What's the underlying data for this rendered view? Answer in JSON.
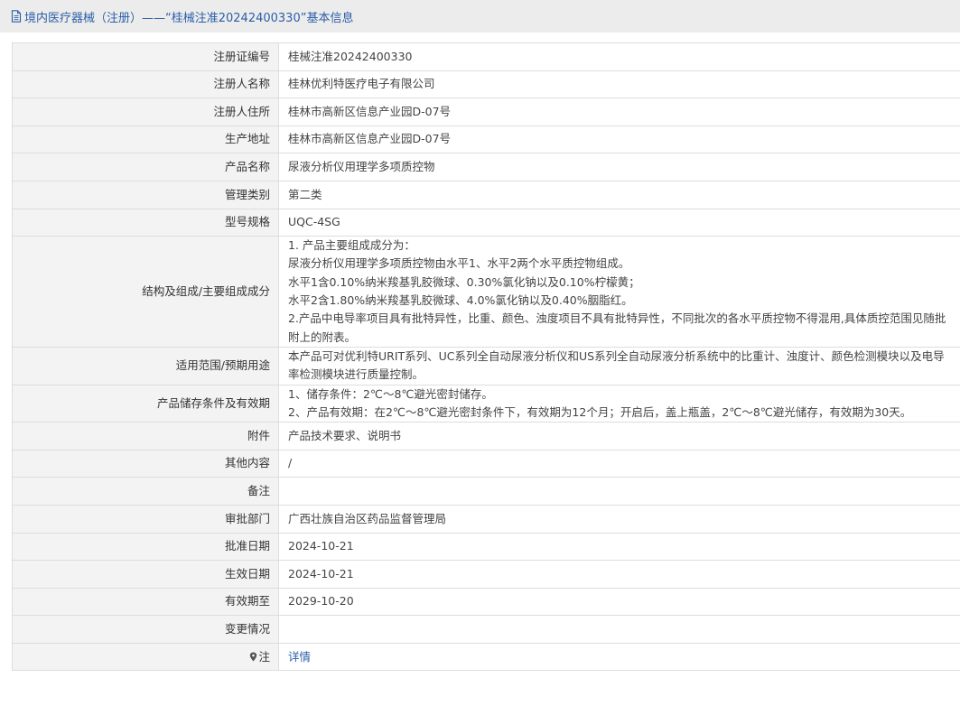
{
  "header": {
    "title": "境内医疗器械（注册）——“桂械注准20242400330”基本信息",
    "icon": "document-icon",
    "color": "#2a5ea8"
  },
  "rows": {
    "reg_no": {
      "label": "注册证编号",
      "value": "桂械注准20242400330"
    },
    "registrant": {
      "label": "注册人名称",
      "value": "桂林优利特医疗电子有限公司"
    },
    "registrant_address": {
      "label": "注册人住所",
      "value": "桂林市高新区信息产业园D-07号"
    },
    "production_address": {
      "label": "生产地址",
      "value": "桂林市高新区信息产业园D-07号"
    },
    "product_name": {
      "label": "产品名称",
      "value": "尿液分析仪用理学多项质控物"
    },
    "management_class": {
      "label": "管理类别",
      "value": "第二类"
    },
    "model": {
      "label": "型号规格",
      "value": "UQC-4SG"
    },
    "composition": {
      "label": "结构及组成/主要组成成分",
      "lines": [
        "1. 产品主要组成成分为：",
        "尿液分析仪用理学多项质控物由水平1、水平2两个水平质控物组成。",
        "水平1含0.10%纳米羧基乳胶微球、0.30%氯化钠以及0.10%柠檬黄；",
        "水平2含1.80%纳米羧基乳胶微球、4.0%氯化钠以及0.40%胭脂红。",
        "2.产品中电导率项目具有批特异性，比重、颜色、浊度项目不具有批特异性，不同批次的各水平质控物不得混用,具体质控范围见随批附上的附表。"
      ]
    },
    "scope": {
      "label": "适用范围/预期用途",
      "value": "本产品可对优利特URIT系列、UC系列全自动尿液分析仪和US系列全自动尿液分析系统中的比重计、浊度计、颜色检测模块以及电导率检测模块进行质量控制。"
    },
    "storage": {
      "label": "产品储存条件及有效期",
      "lines": [
        "1、储存条件：2℃～8℃避光密封储存。",
        "2、产品有效期：在2℃～8℃避光密封条件下，有效期为12个月；开启后，盖上瓶盖，2℃～8℃避光储存，有效期为30天。"
      ]
    },
    "attachments": {
      "label": "附件",
      "value": "产品技术要求、说明书"
    },
    "other": {
      "label": "其他内容",
      "value": "/"
    },
    "remarks": {
      "label": "备注",
      "value": ""
    },
    "approval_dept": {
      "label": "审批部门",
      "value": "广西壮族自治区药品监督管理局"
    },
    "approval_date": {
      "label": "批准日期",
      "value": "2024-10-21"
    },
    "effective_date": {
      "label": "生效日期",
      "value": "2024-10-21"
    },
    "valid_until": {
      "label": "有效期至",
      "value": "2029-10-20"
    },
    "changes": {
      "label": "变更情况",
      "value": ""
    },
    "note": {
      "label": "注",
      "link": "详情",
      "icon": "pin-icon"
    }
  }
}
